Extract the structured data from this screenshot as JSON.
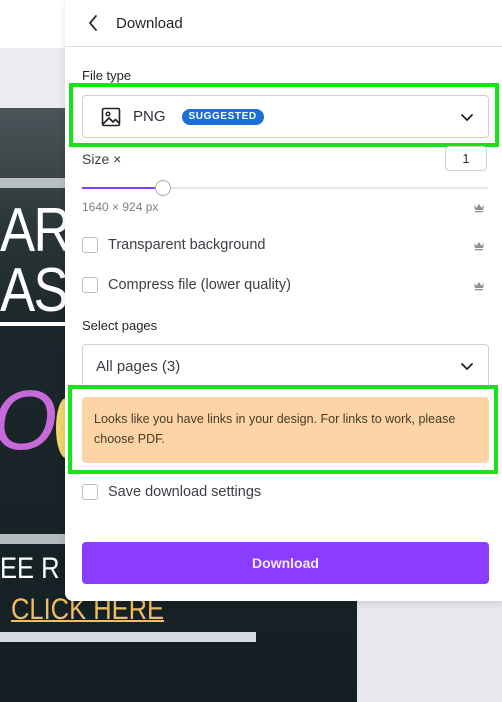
{
  "panel": {
    "title": "Download",
    "back_icon": "chevron-left-icon"
  },
  "file_type": {
    "label": "File type",
    "icon": "image-icon",
    "value": "PNG",
    "badge": "SUGGESTED",
    "badge_color": "#1b6ed6"
  },
  "size": {
    "label": "Size ×",
    "multiplier": "1",
    "slider_fraction": 0.2,
    "dimensions": "1640 × 924 px",
    "premium_icon": "crown-icon"
  },
  "options": [
    {
      "label": "Transparent background",
      "checked": false,
      "premium": true
    },
    {
      "label": "Compress file (lower quality)",
      "checked": false,
      "premium": true
    }
  ],
  "select_pages": {
    "label": "Select pages",
    "value": "All pages (3)"
  },
  "warning": {
    "text": "Looks like you have links in your design. For links to work, please choose PDF.",
    "bg_color": "#fcd4a6"
  },
  "save_settings": {
    "label": "Save download settings",
    "checked": false
  },
  "download_button": {
    "label": "Download",
    "color": "#8b3dff"
  },
  "design_preview": {
    "line1": "AR",
    "line2": "ASI",
    "accent_text": "OO",
    "free_text": "EE R",
    "link_text": "CLICK HERE"
  },
  "highlight_color": "#14e317"
}
